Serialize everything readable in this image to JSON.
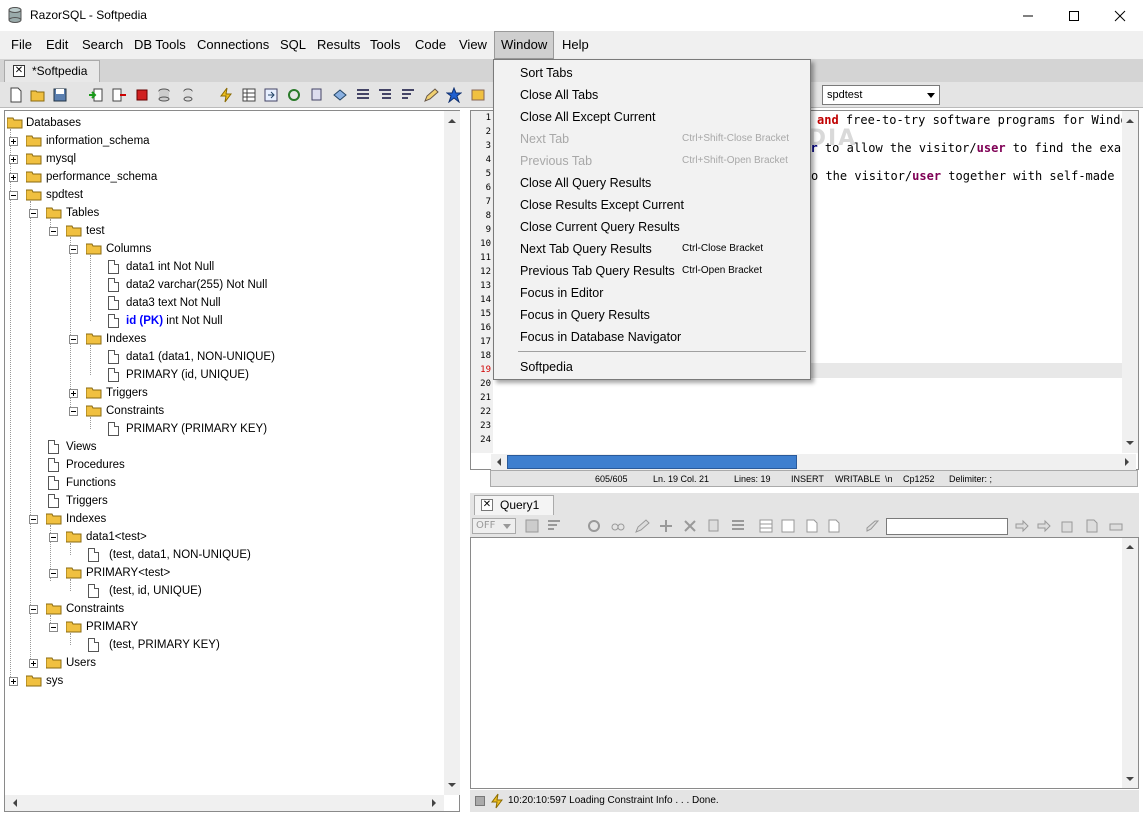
{
  "window": {
    "title": "RazorSQL - Softpedia"
  },
  "menubar": [
    "File",
    "Edit",
    "Search",
    "DB Tools",
    "Connections",
    "SQL",
    "Results",
    "Tools",
    "Code",
    "View",
    "Window",
    "Help"
  ],
  "editor_tab": {
    "label": "*Softpedia"
  },
  "toolbar": {
    "database_select": "spdtest"
  },
  "navigator": {
    "rows": [
      {
        "label": "Databases"
      },
      {
        "label": "information_schema"
      },
      {
        "label": "mysql"
      },
      {
        "label": "performance_schema"
      },
      {
        "label": "spdtest"
      },
      {
        "label": "Tables"
      },
      {
        "label": "test"
      },
      {
        "label": "Columns"
      },
      {
        "label": "data1 int Not Null"
      },
      {
        "label": "data2 varchar(255) Not Null"
      },
      {
        "label": "data3 text Not Null"
      },
      {
        "label": "int Not Null",
        "pk": "id (PK)"
      },
      {
        "label": "Indexes"
      },
      {
        "label": "data1 (data1, NON-UNIQUE)"
      },
      {
        "label": "PRIMARY (id, UNIQUE)"
      },
      {
        "label": "Triggers"
      },
      {
        "label": "Constraints"
      },
      {
        "label": "PRIMARY (PRIMARY KEY)"
      },
      {
        "label": "Views"
      },
      {
        "label": "Procedures"
      },
      {
        "label": "Functions"
      },
      {
        "label": "Triggers"
      },
      {
        "label": "Indexes"
      },
      {
        "label": "data1<test>"
      },
      {
        "label": "(test, data1, NON-UNIQUE)"
      },
      {
        "label": "PRIMARY<test>"
      },
      {
        "label": "(test, id, UNIQUE)"
      },
      {
        "label": "Constraints"
      },
      {
        "label": "PRIMARY"
      },
      {
        "label": "(test, PRIMARY KEY)"
      },
      {
        "label": "Users"
      },
      {
        "label": "sys"
      }
    ]
  },
  "editor": {
    "line_numbers": [
      "1",
      "2",
      "3",
      "4",
      "5",
      "6",
      "7",
      "8",
      "9",
      "10",
      "11",
      "12",
      "13",
      "14",
      "15",
      "16",
      "17",
      "18",
      "19",
      "20",
      "21",
      "22",
      "23",
      "24"
    ],
    "lines": [
      {
        "parts": [
          {
            "t": "and",
            "c": "kw1"
          },
          {
            "t": " free-to-try software programs for Window",
            "c": ""
          }
        ]
      },
      {
        "parts": [
          {
            "t": "der",
            "c": "kw2"
          },
          {
            "t": " to allow the visitor/",
            "c": ""
          },
          {
            "t": "user",
            "c": "kw3"
          },
          {
            "t": " to find the exa",
            "c": ""
          }
        ]
      },
      {
        "parts": [
          {
            "t": "o the visitor/",
            "c": ""
          },
          {
            "t": "user",
            "c": "kw3"
          },
          {
            "t": " together with self-made ev",
            "c": ""
          }
        ]
      }
    ],
    "watermark": "SOFTPEDIA"
  },
  "status": {
    "position": "605/605",
    "cursor": "Ln. 19 Col. 21",
    "lines": "Lines: 19",
    "mode": "INSERT",
    "writable": "WRITABLE",
    "newline": "\\n",
    "encoding": "Cp1252",
    "delimiter": "Delimiter: ;"
  },
  "results": {
    "tab_label": "Query1",
    "auto_select": "OFF",
    "search_value": ""
  },
  "bottom_status": "10:20:10:597 Loading Constraint Info . . . Done.",
  "window_menu": {
    "items": [
      {
        "label": "Sort Tabs",
        "shortcut": "",
        "disabled": false
      },
      {
        "label": "Close All Tabs",
        "shortcut": "",
        "disabled": false
      },
      {
        "label": "Close All Except Current",
        "shortcut": "",
        "disabled": false
      },
      {
        "label": "Next Tab",
        "shortcut": "Ctrl+Shift-Close Bracket",
        "disabled": true
      },
      {
        "label": "Previous Tab",
        "shortcut": "Ctrl+Shift-Open Bracket",
        "disabled": true
      },
      {
        "label": "Close All Query Results",
        "shortcut": "",
        "disabled": false
      },
      {
        "label": "Close Results Except Current",
        "shortcut": "",
        "disabled": false
      },
      {
        "label": "Close Current Query Results",
        "shortcut": "",
        "disabled": false
      },
      {
        "label": "Next Tab Query Results",
        "shortcut": "Ctrl-Close Bracket",
        "disabled": false
      },
      {
        "label": "Previous Tab Query Results",
        "shortcut": "Ctrl-Open Bracket",
        "disabled": false
      },
      {
        "label": "Focus in Editor",
        "shortcut": "",
        "disabled": false
      },
      {
        "label": "Focus in Query Results",
        "shortcut": "",
        "disabled": false
      },
      {
        "label": "Focus in Database Navigator",
        "shortcut": "",
        "disabled": false
      }
    ],
    "footer_item": "Softpedia"
  },
  "colors": {
    "accent": "#1f6fd6",
    "menu_bg": "#f2f2f2",
    "pk_text": "#0000ff",
    "highlight_line": "#e8e8e8"
  }
}
